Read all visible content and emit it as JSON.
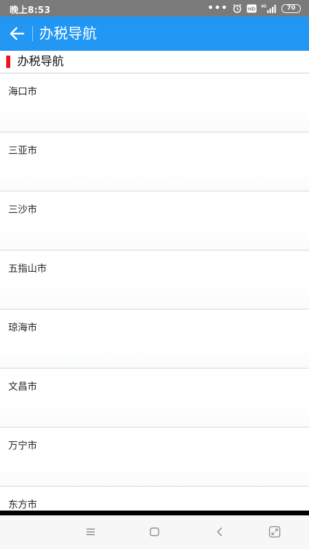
{
  "status_bar": {
    "time": "晚上8:53",
    "battery": "70",
    "network": "4G",
    "hd_badge": "HD",
    "icons": [
      "more-dots-icon",
      "alarm-icon",
      "hd-icon",
      "signal-4g-icon",
      "battery-icon"
    ]
  },
  "app_bar": {
    "title": "办税导航",
    "back_icon": "arrow-left-icon"
  },
  "section": {
    "title": "办税导航"
  },
  "cities": [
    {
      "name": "海口市"
    },
    {
      "name": "三亚市"
    },
    {
      "name": "三沙市"
    },
    {
      "name": "五指山市"
    },
    {
      "name": "琼海市"
    },
    {
      "name": "文昌市"
    },
    {
      "name": "万宁市"
    },
    {
      "name": "东方市"
    }
  ],
  "nav_bar": {
    "icons": [
      "menu-icon",
      "home-square-icon",
      "back-chevron-icon",
      "screen-expand-icon"
    ]
  },
  "colors": {
    "app_bar": "#2196f3",
    "status_bar": "#7a7a7a",
    "section_marker": "#e8161b"
  }
}
